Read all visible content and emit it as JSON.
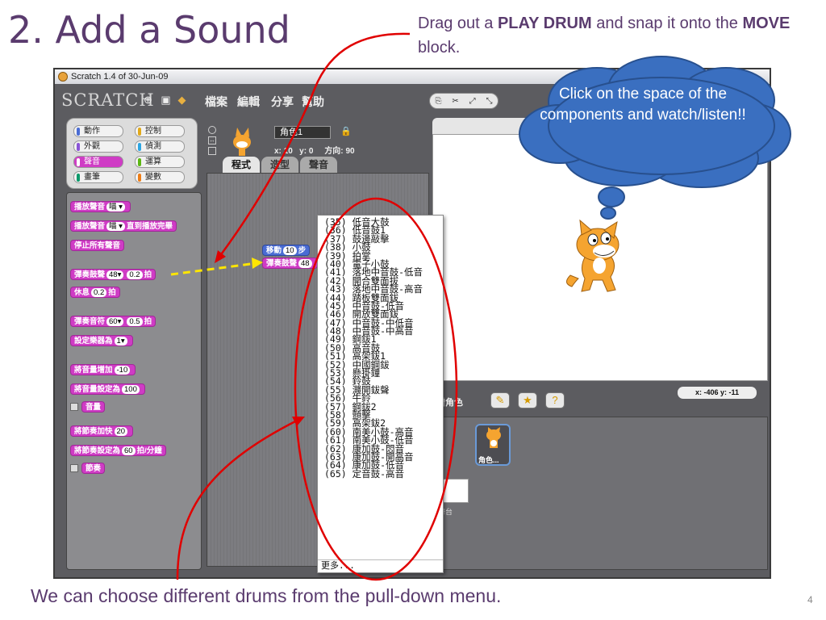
{
  "slide": {
    "title": "2. Add a Sound",
    "instruction_pre": "Drag out a ",
    "instruction_b1": "PLAY DRUM",
    "instruction_mid": " and snap it onto the ",
    "instruction_b2": "MOVE",
    "instruction_post": " block.",
    "bottom_caption": "We can choose different drums from the pull-down menu.",
    "page_number": "4",
    "cloud_text": "Click on the space of the  components and watch/listen!!"
  },
  "window": {
    "title": "Scratch 1.4 of 30-Jun-09",
    "logo": "SCRATCH",
    "menus": [
      "檔案",
      "編輯",
      "分享",
      "幫助"
    ]
  },
  "categories": {
    "items": [
      {
        "label": "動作",
        "color": "#4a6cd4"
      },
      {
        "label": "控制",
        "color": "#e1a91a"
      },
      {
        "label": "外觀",
        "color": "#8a55d7"
      },
      {
        "label": "偵測",
        "color": "#2ca5e2"
      },
      {
        "label": "聲音",
        "color": "#cf3cc5"
      },
      {
        "label": "運算",
        "color": "#5cb712"
      },
      {
        "label": "畫筆",
        "color": "#0e9a6c"
      },
      {
        "label": "變數",
        "color": "#ee7d16"
      }
    ],
    "selected": "聲音"
  },
  "palette": {
    "play_sound": "播放聲音",
    "meow": "喵",
    "play_sound_until_done": "直到播放完畢",
    "stop_all_sounds": "停止所有聲音",
    "play_drum": "彈奏鼓聲",
    "drum_value": "48",
    "drum_beats": "0.2",
    "beats_unit": "拍",
    "rest_for": "休息",
    "rest_value": "0.2",
    "play_note": "彈奏音符",
    "note_value": "60",
    "note_beats": "0.5",
    "set_instrument": "設定樂器為",
    "instrument_value": "1",
    "change_volume": "將音量增加",
    "change_volume_value": "-10",
    "set_volume": "將音量設定為",
    "set_volume_value": "100",
    "volume_reporter": "音量",
    "change_tempo": "將節奏加快",
    "change_tempo_value": "20",
    "set_tempo": "將節奏設定為",
    "set_tempo_value": "60",
    "tempo_unit": "拍/分鐘",
    "tempo_reporter": "節奏"
  },
  "sprite": {
    "name": "角色1",
    "x_label": "x:",
    "x_value": "10",
    "y_label": "y:",
    "y_value": "0",
    "direction_label": "方向:",
    "direction_value": "90",
    "tabs": [
      "程式",
      "造型",
      "聲音"
    ]
  },
  "script": {
    "move_label": "移動",
    "move_value": "10",
    "move_unit": "步",
    "drum_label": "彈奏鼓聲",
    "drum_value": "48"
  },
  "stage": {
    "new_sprite_label": "新增角色",
    "coords": "x: -406  y: -11",
    "sprite_thumb_label": "角色...",
    "stage_label": "舞台"
  },
  "dropdown": {
    "items": [
      "(35) 低音大鼓",
      "(36) 低音鼓1",
      "(37) 鼓邊敲擊",
      "(38) 小鼓",
      "(39) 拍掌",
      "(40) 電子小鼓",
      "(41) 落地中音鼓-低音",
      "(42) 開合雙面拔",
      "(43) 落地中音鼓-高音",
      "(44) 踏板雙面鈸",
      "(45) 中音鼓-低音",
      "(46) 開放雙面鈸",
      "(47) 中音鼓-中低音",
      "(48) 中音鼓-中高音",
      "(49) 鋼鈸1",
      "(50) 高音鼓",
      "(51) 高架鈸1",
      "(52) 中國鋼鈸",
      "(53) 懸掛鐘",
      "(54) 鈴鼓",
      "(55) 濺開鈸聲",
      "(56) 牛鈴",
      "(57) 鋼鈸2",
      "(58) 顫擊",
      "(59) 高架鈸2",
      "(60) 南美小鼓-高音",
      "(61) 南美小鼓-低音",
      "(62) 康加鼓-悶音",
      "(63) 康加鼓-開高音",
      "(64) 康加鼓-低音",
      "(65) 定音鼓-高音"
    ],
    "more": "更多..."
  },
  "colors": {
    "slide_text": "#5a3b6e",
    "annotation_red": "#e00000",
    "cloud_fill": "#3a6fc0",
    "sound_block": "#cf3cc5",
    "motion_block": "#4a6cd4"
  }
}
